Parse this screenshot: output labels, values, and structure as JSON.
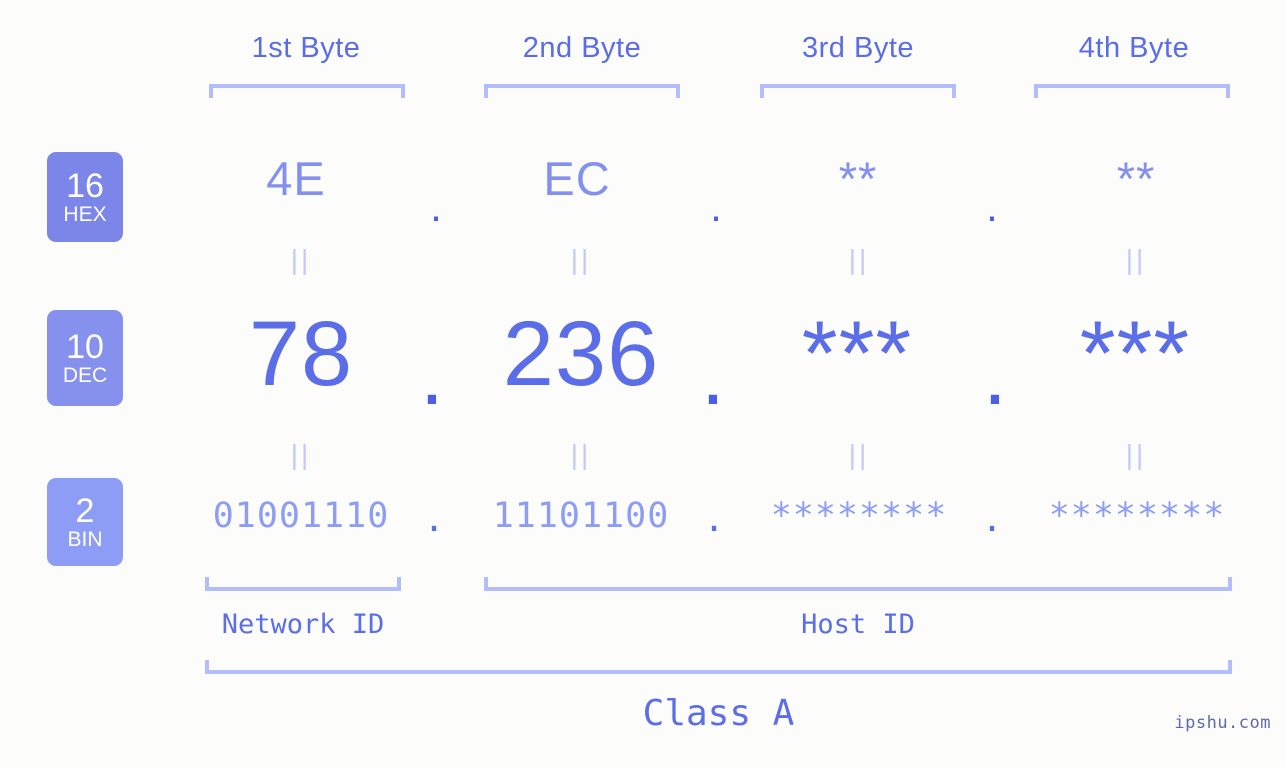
{
  "colors": {
    "background": "#fcfdfa",
    "accent_strong": "#5b6ee8",
    "accent_mid": "#8490ee",
    "accent_light": "#8d9cf5",
    "bracket": "#b4bdfb",
    "badge_hex": "#7b86e8",
    "badge_dec": "#8691ee",
    "badge_bin": "#8d9cf5",
    "eq_mark": "#c3caf8"
  },
  "byte_headers": [
    {
      "label": "1st Byte"
    },
    {
      "label": "2nd Byte"
    },
    {
      "label": "3rd Byte"
    },
    {
      "label": "4th Byte"
    }
  ],
  "bases": [
    {
      "number": "16",
      "name": "HEX"
    },
    {
      "number": "10",
      "name": "DEC"
    },
    {
      "number": "2",
      "name": "BIN"
    }
  ],
  "rows": {
    "hex": {
      "base_number": "16",
      "base_name": "HEX",
      "octets": [
        "4E",
        "EC",
        "**",
        "**"
      ],
      "separators": [
        ".",
        ".",
        "."
      ]
    },
    "dec": {
      "base_number": "10",
      "base_name": "DEC",
      "octets": [
        "78",
        "236",
        "***",
        "***"
      ],
      "separators": [
        ".",
        ".",
        "."
      ]
    },
    "bin": {
      "base_number": "2",
      "base_name": "BIN",
      "octets": [
        "01001110",
        "11101100",
        "********",
        "********"
      ],
      "separators": [
        ".",
        ".",
        "."
      ]
    }
  },
  "equals_marks": {
    "hex_to_dec": [
      "||",
      "||",
      "||",
      "||"
    ],
    "dec_to_bin": [
      "||",
      "||",
      "||",
      "||"
    ]
  },
  "id_sections": [
    {
      "label": "Network ID"
    },
    {
      "label": "Host ID"
    }
  ],
  "class": {
    "label": "Class A"
  },
  "watermark": {
    "text": "ipshu.com"
  }
}
